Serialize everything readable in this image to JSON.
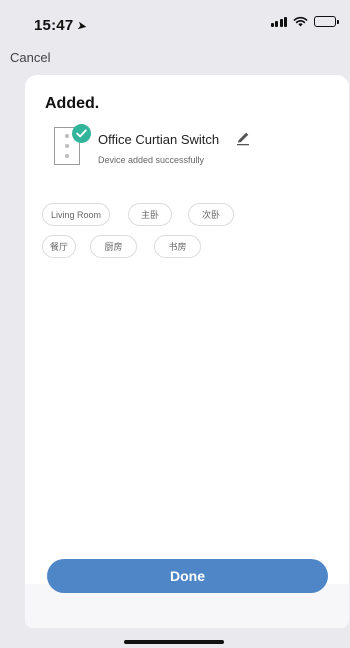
{
  "status_bar": {
    "time": "15:47",
    "location_glyph": "➤",
    "icons": [
      "signal-icon",
      "wifi-icon",
      "battery-icon"
    ]
  },
  "nav": {
    "cancel_label": "Cancel"
  },
  "card": {
    "title": "Added.",
    "device": {
      "name": "Office Curtian Switch",
      "status": "Device added successfully",
      "icons": [
        "switch-device-icon",
        "check-icon",
        "edit-pencil-icon"
      ]
    },
    "rooms": [
      "Living Room",
      "主卧",
      "次卧",
      "餐厅",
      "厨房",
      "书房"
    ],
    "done_label": "Done"
  },
  "colors": {
    "accent": "#4f86c8",
    "success": "#30b59b",
    "background": "#e9e9ee",
    "card": "#ffffff"
  }
}
